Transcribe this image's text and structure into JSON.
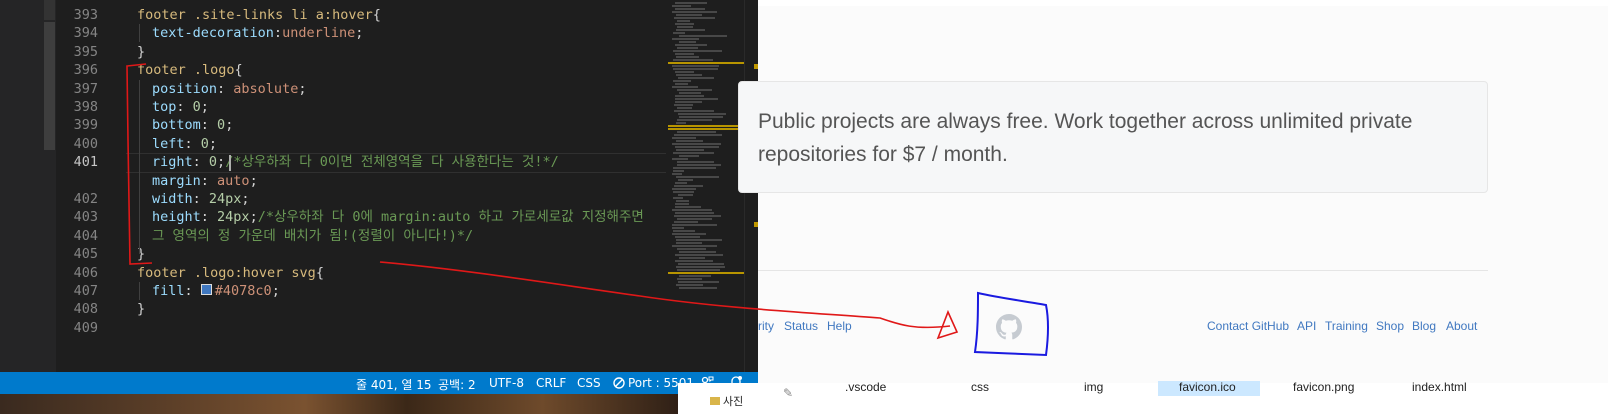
{
  "editor": {
    "lines": [
      {
        "n": 393,
        "segments": [
          [
            "sel",
            "footer .site-links li a:hover"
          ],
          [
            "pun",
            "{"
          ]
        ],
        "indent": 0
      },
      {
        "n": 394,
        "segments": [
          [
            "prop",
            "text-decoration"
          ],
          [
            "pun",
            ":"
          ],
          [
            "val",
            "underline"
          ],
          [
            "pun",
            ";"
          ]
        ],
        "indent": 1
      },
      {
        "n": 395,
        "segments": [
          [
            "pun",
            "}"
          ]
        ],
        "indent": 0
      },
      {
        "n": 396,
        "segments": [
          [
            "sel",
            "footer .logo"
          ],
          [
            "pun",
            "{"
          ]
        ],
        "indent": 0
      },
      {
        "n": 397,
        "segments": [
          [
            "prop",
            "position"
          ],
          [
            "pun",
            ": "
          ],
          [
            "val",
            "absolute"
          ],
          [
            "pun",
            ";"
          ]
        ],
        "indent": 1
      },
      {
        "n": 398,
        "segments": [
          [
            "prop",
            "top"
          ],
          [
            "pun",
            ": "
          ],
          [
            "num",
            "0"
          ],
          [
            "pun",
            ";"
          ]
        ],
        "indent": 1
      },
      {
        "n": 399,
        "segments": [
          [
            "prop",
            "bottom"
          ],
          [
            "pun",
            ": "
          ],
          [
            "num",
            "0"
          ],
          [
            "pun",
            ";"
          ]
        ],
        "indent": 1
      },
      {
        "n": 400,
        "segments": [
          [
            "prop",
            "left"
          ],
          [
            "pun",
            ": "
          ],
          [
            "num",
            "0"
          ],
          [
            "pun",
            ";"
          ]
        ],
        "indent": 1
      },
      {
        "n": 401,
        "segments": [
          [
            "prop",
            "right"
          ],
          [
            "pun",
            ": "
          ],
          [
            "num",
            "0"
          ],
          [
            "pun",
            ";"
          ],
          [
            "cmt",
            "/*상우하좌 다 0이면 전체영역을 다 사용한다는 것!*/"
          ]
        ],
        "indent": 1
      },
      {
        "n": 402,
        "segments": [
          [
            "prop",
            "margin"
          ],
          [
            "pun",
            ": "
          ],
          [
            "val",
            "auto"
          ],
          [
            "pun",
            ";"
          ]
        ],
        "indent": 1
      },
      {
        "n": 403,
        "segments": [
          [
            "prop",
            "width"
          ],
          [
            "pun",
            ": "
          ],
          [
            "num",
            "24px"
          ],
          [
            "pun",
            ";"
          ]
        ],
        "indent": 1
      },
      {
        "n": 404,
        "segments": [
          [
            "prop",
            "height"
          ],
          [
            "pun",
            ": "
          ],
          [
            "num",
            "24px"
          ],
          [
            "pun",
            ";"
          ],
          [
            "cmt",
            "/*상우하좌 다 0에 margin:auto 하고 가로세로값 지정해주면"
          ]
        ],
        "indent": 1
      },
      {
        "n": null,
        "segments": [
          [
            "cmt",
            "그 영역의 정 가운데 배치가 됨!(정렬이 아니다!)*/"
          ]
        ],
        "indent": 1
      },
      {
        "n": 405,
        "segments": [
          [
            "pun",
            "}"
          ]
        ],
        "indent": 0
      },
      {
        "n": 406,
        "segments": [
          [
            "sel",
            "footer .logo:hover svg"
          ],
          [
            "pun",
            "{"
          ]
        ],
        "indent": 0
      },
      {
        "n": 407,
        "segments": [
          [
            "prop",
            "fill"
          ],
          [
            "pun",
            ": "
          ],
          [
            "swatch",
            ""
          ],
          [
            "val",
            "#4078c0"
          ],
          [
            "pun",
            ";"
          ]
        ],
        "indent": 1
      },
      {
        "n": 408,
        "segments": [
          [
            "pun",
            "}"
          ]
        ],
        "indent": 0
      }
    ],
    "gutter_numbers": [
      "393",
      "394",
      "395",
      "396",
      "397",
      "398",
      "399",
      "400",
      "401",
      "",
      "402",
      "403",
      "404",
      "405",
      "406",
      "407",
      "408",
      "409"
    ],
    "active_line": "401",
    "accent_color": "#007acc"
  },
  "statusbar": {
    "position": "줄 401, 열 15",
    "spaces": "공백: 2",
    "encoding": "UTF-8",
    "eol": "CRLF",
    "language": "CSS",
    "port": "Port : 5501",
    "feedback_icon": "person-feedback-icon",
    "bell_icon": "bell-icon"
  },
  "browser": {
    "promo_text": "Public projects are always free. Work together across unlimited private repositories for $7 / month.",
    "footer_left": [
      "rity",
      "Status",
      "Help"
    ],
    "footer_right": [
      "Contact GitHub",
      "API",
      "Training",
      "Shop",
      "Blog",
      "About"
    ],
    "logo_icon": "github-octocat-icon",
    "link_color": "#4078c0"
  },
  "explorer": {
    "files": [
      ".vscode",
      "css",
      "img",
      "favicon.ico",
      "favicon.png",
      "index.html"
    ],
    "selected": "favicon.ico",
    "photo_label": "사진"
  }
}
